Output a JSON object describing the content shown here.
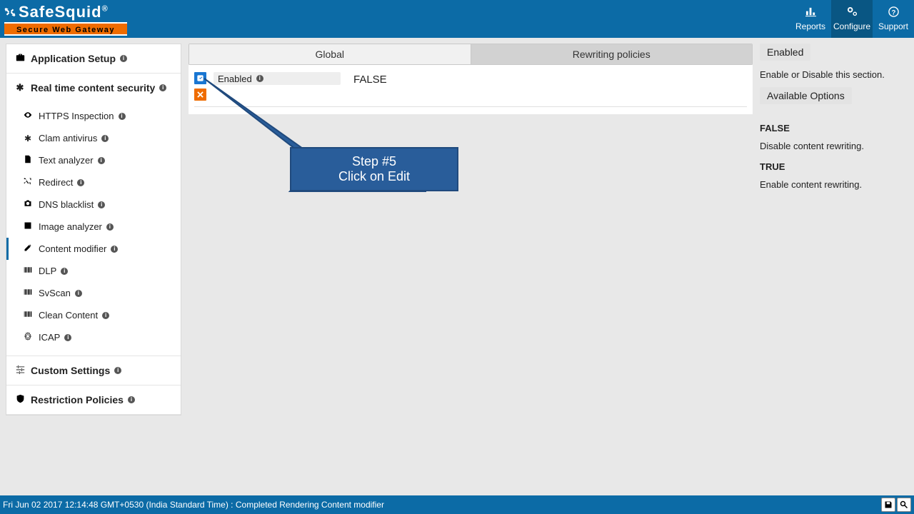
{
  "header": {
    "brand": "SafeSquid",
    "reg": "®",
    "tagline": "Secure Web Gateway",
    "nav": {
      "reports": "Reports",
      "configure": "Configure",
      "support": "Support"
    }
  },
  "sidebar": {
    "app_setup": "Application Setup",
    "realtime": "Real time content security",
    "items": [
      {
        "label": "HTTPS Inspection"
      },
      {
        "label": "Clam antivirus"
      },
      {
        "label": "Text analyzer"
      },
      {
        "label": "Redirect"
      },
      {
        "label": "DNS blacklist"
      },
      {
        "label": "Image analyzer"
      },
      {
        "label": "Content modifier"
      },
      {
        "label": "DLP"
      },
      {
        "label": "SvScan"
      },
      {
        "label": "Clean Content"
      },
      {
        "label": "ICAP"
      }
    ],
    "custom": "Custom Settings",
    "restriction": "Restriction Policies"
  },
  "tabs": {
    "global": "Global",
    "policies": "Rewriting policies"
  },
  "row": {
    "label": "Enabled",
    "value": "FALSE"
  },
  "aside": {
    "enabled": "Enabled",
    "desc": "Enable or Disable this section.",
    "options": "Available Options",
    "false_name": "FALSE",
    "false_desc": "Disable content rewriting.",
    "true_name": "TRUE",
    "true_desc": "Enable content rewriting."
  },
  "callout": {
    "line1": "Step #5",
    "line2": "Click on Edit"
  },
  "footer": {
    "status": "Fri Jun 02 2017 12:14:48 GMT+0530 (India Standard Time) : Completed Rendering Content modifier"
  }
}
